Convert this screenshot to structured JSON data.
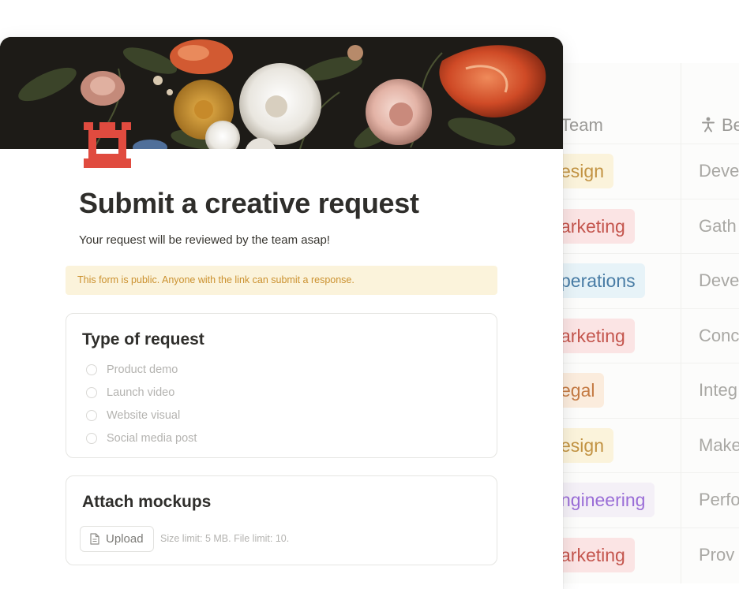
{
  "background_table": {
    "columns": [
      {
        "label": "Team",
        "icon": "multi-select-icon"
      },
      {
        "label": "Be",
        "icon": "person-icon"
      }
    ],
    "rows": [
      {
        "team": "esign",
        "team_bg": "#fbf3db",
        "team_color": "#c29343",
        "second": "Deve"
      },
      {
        "team": "arketing",
        "team_bg": "#fbe4e4",
        "team_color": "#c4554d",
        "second": "Gath"
      },
      {
        "team": "perations",
        "team_bg": "#e7f3f8",
        "team_color": "#487ca5",
        "second": "Deve"
      },
      {
        "team": "arketing",
        "team_bg": "#fbe4e4",
        "team_color": "#c4554d",
        "second": "Conc"
      },
      {
        "team": "egal",
        "team_bg": "#fbecdd",
        "team_color": "#c47a43",
        "second": "Integ"
      },
      {
        "team": "esign",
        "team_bg": "#fbf3db",
        "team_color": "#c29343",
        "second": "Make"
      },
      {
        "team": "ngineering",
        "team_bg": "#f4f0f7",
        "team_color": "#9a6dd7",
        "second": "Perfo"
      },
      {
        "team": "arketing",
        "team_bg": "#fbe4e4",
        "team_color": "#c4554d",
        "second": "Prov"
      }
    ]
  },
  "form": {
    "cover": "floral-still-life-painting",
    "logo_icon": "castle-tower-icon",
    "title": "Submit a creative request",
    "description": "Your request will be reviewed by the team asap!",
    "notice": "This form is public. Anyone with the link can submit a response.",
    "questions": [
      {
        "title": "Type of request",
        "options": [
          "Product demo",
          "Launch video",
          "Website visual",
          "Social media post"
        ]
      },
      {
        "title": "Attach mockups",
        "upload_label": "Upload",
        "upload_icon": "file-icon",
        "hint": "Size limit: 5 MB. File limit: 10."
      }
    ]
  },
  "colors": {
    "logo": "#e04b3f",
    "notice_bg": "#fbf3db",
    "notice_text": "#cb912f"
  }
}
